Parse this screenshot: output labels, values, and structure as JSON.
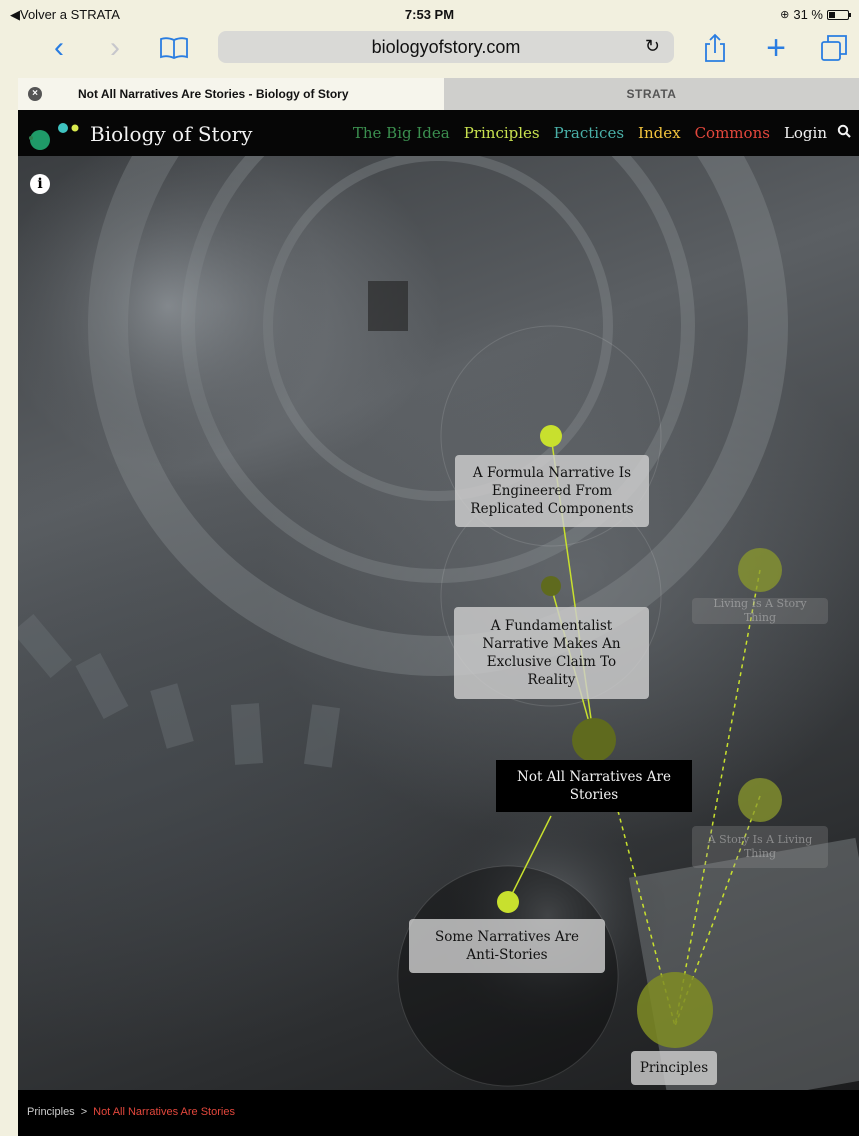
{
  "status_bar": {
    "back_app": "◀Volver a STRATA",
    "time": "7:53 PM",
    "battery": "31 %"
  },
  "toolbar": {
    "url": "biologyofstory.com"
  },
  "tabs": [
    {
      "label": "Not All Narratives Are Stories - Biology of Story",
      "active": true
    },
    {
      "label": "STRATA",
      "active": false
    }
  ],
  "site": {
    "logo_text": "Biology of Story",
    "nav": {
      "big_idea": "The Big Idea",
      "principles": "Principles",
      "practices": "Practices",
      "index": "Index",
      "commons": "Commons",
      "login": "Login"
    },
    "colors": {
      "big_idea": "#3b8f4f",
      "principles": "#c8e14f",
      "practices": "#4ab0a8",
      "index": "#f0c23d",
      "commons": "#e2473c",
      "node_bright": "#c8e02e",
      "node_dark": "#5f6a1e"
    },
    "nodes": {
      "formula": "A Formula Narrative Is Engineered From Replicated Components",
      "fundamentalist": "A Fundamentalist Narrative Makes An Exclusive Claim To Reality",
      "current": "Not All Narratives Are Stories",
      "living": "Living Is A Story Thing",
      "story_living": "A Story Is A Living Thing",
      "anti": "Some Narratives Are Anti-Stories",
      "principles": "Principles"
    },
    "breadcrumb": {
      "root": "Principles",
      "separator": ">",
      "current": "Not All Narratives Are Stories"
    }
  }
}
